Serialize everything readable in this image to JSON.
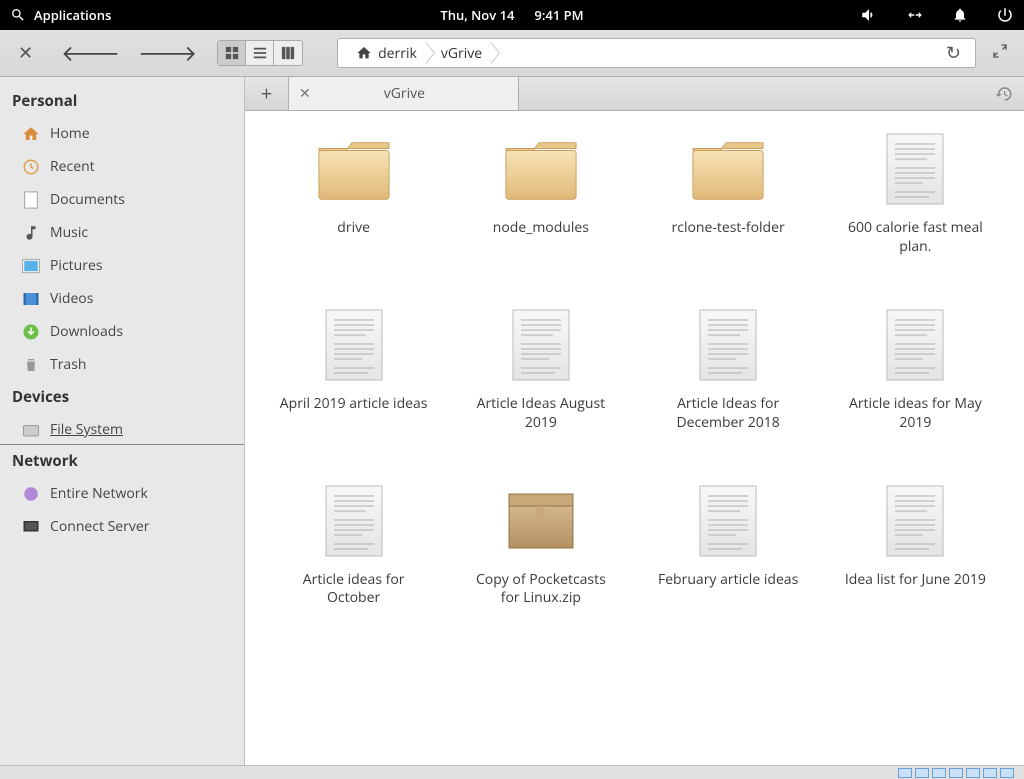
{
  "topbar": {
    "apps_label": "Applications",
    "date": "Thu, Nov 14",
    "time": "9:41 PM"
  },
  "breadcrumb": {
    "parts": [
      "derrik",
      "vGrive"
    ]
  },
  "sidebar": {
    "sections": [
      {
        "title": "Personal",
        "items": [
          {
            "label": "Home",
            "icon": "home"
          },
          {
            "label": "Recent",
            "icon": "recent"
          },
          {
            "label": "Documents",
            "icon": "doc"
          },
          {
            "label": "Music",
            "icon": "music"
          },
          {
            "label": "Pictures",
            "icon": "pictures"
          },
          {
            "label": "Videos",
            "icon": "videos"
          },
          {
            "label": "Downloads",
            "icon": "downloads"
          },
          {
            "label": "Trash",
            "icon": "trash"
          }
        ]
      },
      {
        "title": "Devices",
        "items": [
          {
            "label": "File System",
            "icon": "disk",
            "selected": true
          }
        ]
      },
      {
        "title": "Network",
        "items": [
          {
            "label": "Entire Network",
            "icon": "network"
          },
          {
            "label": "Connect Server",
            "icon": "server"
          }
        ]
      }
    ]
  },
  "tab": {
    "title": "vGrive"
  },
  "files": [
    {
      "type": "folder",
      "name": "drive"
    },
    {
      "type": "folder",
      "name": "node_modules"
    },
    {
      "type": "folder",
      "name": "rclone-test-folder"
    },
    {
      "type": "doc",
      "name": "600 calorie fast meal plan."
    },
    {
      "type": "doc",
      "name": "April 2019 article ideas"
    },
    {
      "type": "doc",
      "name": "Article Ideas August 2019"
    },
    {
      "type": "doc",
      "name": "Article Ideas for December 2018"
    },
    {
      "type": "doc",
      "name": "Article ideas for May 2019"
    },
    {
      "type": "doc",
      "name": "Article ideas for October"
    },
    {
      "type": "archive",
      "name": "Copy of Pocketcasts for Linux.zip"
    },
    {
      "type": "doc",
      "name": "February article ideas"
    },
    {
      "type": "doc",
      "name": "Idea list for June 2019"
    }
  ]
}
